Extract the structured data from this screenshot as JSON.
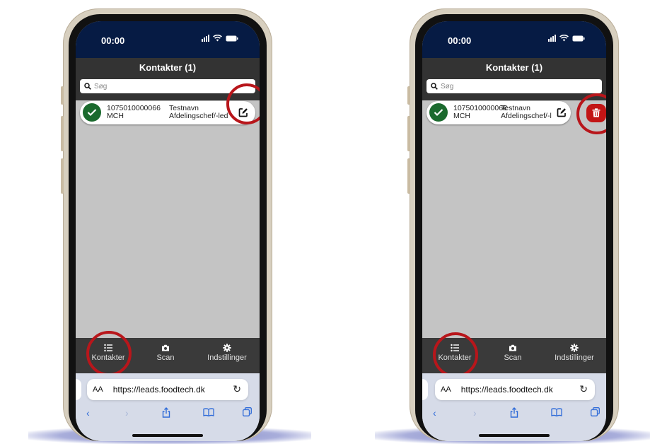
{
  "status": {
    "time": "00:00"
  },
  "header": {
    "title": "Kontakter (1)"
  },
  "search": {
    "placeholder": "Søg"
  },
  "contact": {
    "id_line1_left": "1075010000066",
    "id_line1_right": "107501000006€",
    "id_line2": "MCH",
    "name_line1": "Testnavn",
    "name_line2_left": "Afdelingschef/-led",
    "name_line2_right": "Afdelingschef/-l"
  },
  "tabs": [
    {
      "label": "Kontakter",
      "icon": "list-icon"
    },
    {
      "label": "Scan",
      "icon": "camera-icon"
    },
    {
      "label": "Indstillinger",
      "icon": "gear-icon"
    }
  ],
  "browser": {
    "aa": "AA",
    "url": "https://leads.foodtech.dk"
  },
  "colors": {
    "status_bg": "#061b44",
    "success": "#1b6a2e",
    "danger": "#c21515",
    "highlight_circle": "#b8161b",
    "safari_blue": "#2f6bd8"
  }
}
